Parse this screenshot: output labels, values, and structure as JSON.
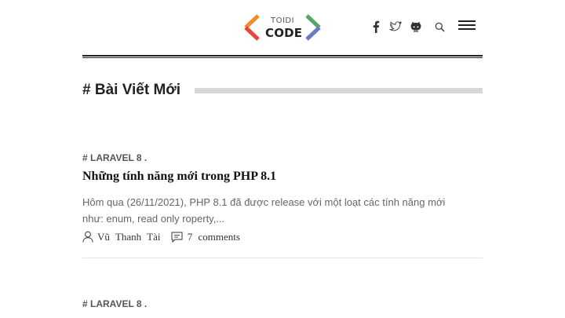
{
  "brand": {
    "line1": "TOIDI",
    "line2": "CODE"
  },
  "nav_icons": [
    "facebook-icon",
    "twitter-icon",
    "github-icon",
    "search-icon",
    "menu-icon"
  ],
  "colors": {
    "logo_orange": "#f28c28",
    "logo_red": "#e8453c",
    "logo_green": "#5aa469",
    "logo_blue": "#6a7bbf",
    "rule": "#222222",
    "muted_text": "#666666"
  },
  "section": {
    "title": "# Bài Viết Mới"
  },
  "posts": [
    {
      "category": "# LARAVEL 8 .",
      "title": "Những tính năng mới trong PHP 8.1",
      "excerpt_line1": "Hôm qua (26/11/2021), PHP 8.1 đã được release với một loạt các tính năng mới",
      "excerpt_line2": "như: enum, read only roperty,...",
      "author": "Vũ Thanh Tài",
      "comments": "7 comments"
    },
    {
      "category": "# LARAVEL 8 ."
    }
  ]
}
